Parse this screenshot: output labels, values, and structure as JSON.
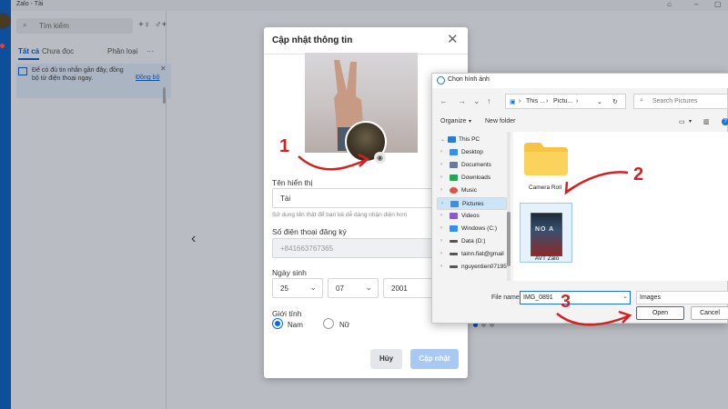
{
  "app": {
    "title": "Zalo - Tài",
    "search_placeholder": "Tìm kiếm",
    "tabs": [
      "Tất cả",
      "Chưa đọc"
    ],
    "filter_label": "Phân loại",
    "more_label": "···",
    "sync_message": "Để có đủ tin nhắn gần đây, đồng bộ từ điện thoại ngay.",
    "sync_link": "Đồng bộ",
    "close_glyph": "✕"
  },
  "dialog": {
    "title": "Cập nhật thông tin",
    "display_name_label": "Tên hiển thị",
    "display_name_value": "Tài",
    "display_name_hint": "Sử dụng tên thật để bạn bè dễ dàng nhận diện hơn",
    "phone_label": "Số điện thoại đăng ký",
    "phone_value": "+841663767365",
    "dob_label": "Ngày sinh",
    "dob_day": "25",
    "dob_month": "07",
    "dob_year": "2001",
    "gender_label": "Giới tính",
    "gender_options": [
      "Nam",
      "Nữ"
    ],
    "gender_selected": "Nam",
    "cancel_label": "Hủy",
    "update_label": "Cập nhật"
  },
  "picker": {
    "title": "Chọn hình ảnh",
    "address_segments": [
      "This ...",
      "Pictu..."
    ],
    "search_placeholder": "Search Pictures",
    "organize_label": "Organize",
    "new_folder_label": "New folder",
    "tree": [
      {
        "label": "This PC",
        "icon_color": "#2d7dd2"
      },
      {
        "label": "Desktop",
        "icon_color": "#3a8ee6"
      },
      {
        "label": "Documents",
        "icon_color": "#6a7c95"
      },
      {
        "label": "Downloads",
        "icon_color": "#27a35a"
      },
      {
        "label": "Music",
        "icon_color": "#d9534f"
      },
      {
        "label": "Pictures",
        "icon_color": "#3a8ee6"
      },
      {
        "label": "Videos",
        "icon_color": "#8a5cc7"
      },
      {
        "label": "Windows (C:)",
        "icon_color": "#3a8ee6"
      },
      {
        "label": "Data (D:)",
        "icon_color": "#555555"
      },
      {
        "label": "tainn.fiat@gmail",
        "icon_color": "#555555"
      },
      {
        "label": "nguyentien07195",
        "icon_color": "#555555"
      }
    ],
    "files": [
      {
        "name": "Camera Roll",
        "kind": "folder"
      },
      {
        "name": "AVT Zalo",
        "kind": "image",
        "poster_text": "NO A"
      }
    ],
    "file_name_label": "File name:",
    "file_name_value": "IMG_0891",
    "file_type_value": "Images",
    "open_label": "Open",
    "cancel_label": "Cancel"
  },
  "annotations": [
    "1",
    "2",
    "3"
  ],
  "colors": {
    "zalo_blue": "#0068ff",
    "annotation_red": "#d61f1f",
    "nav_blue": "#0e4f9c"
  }
}
